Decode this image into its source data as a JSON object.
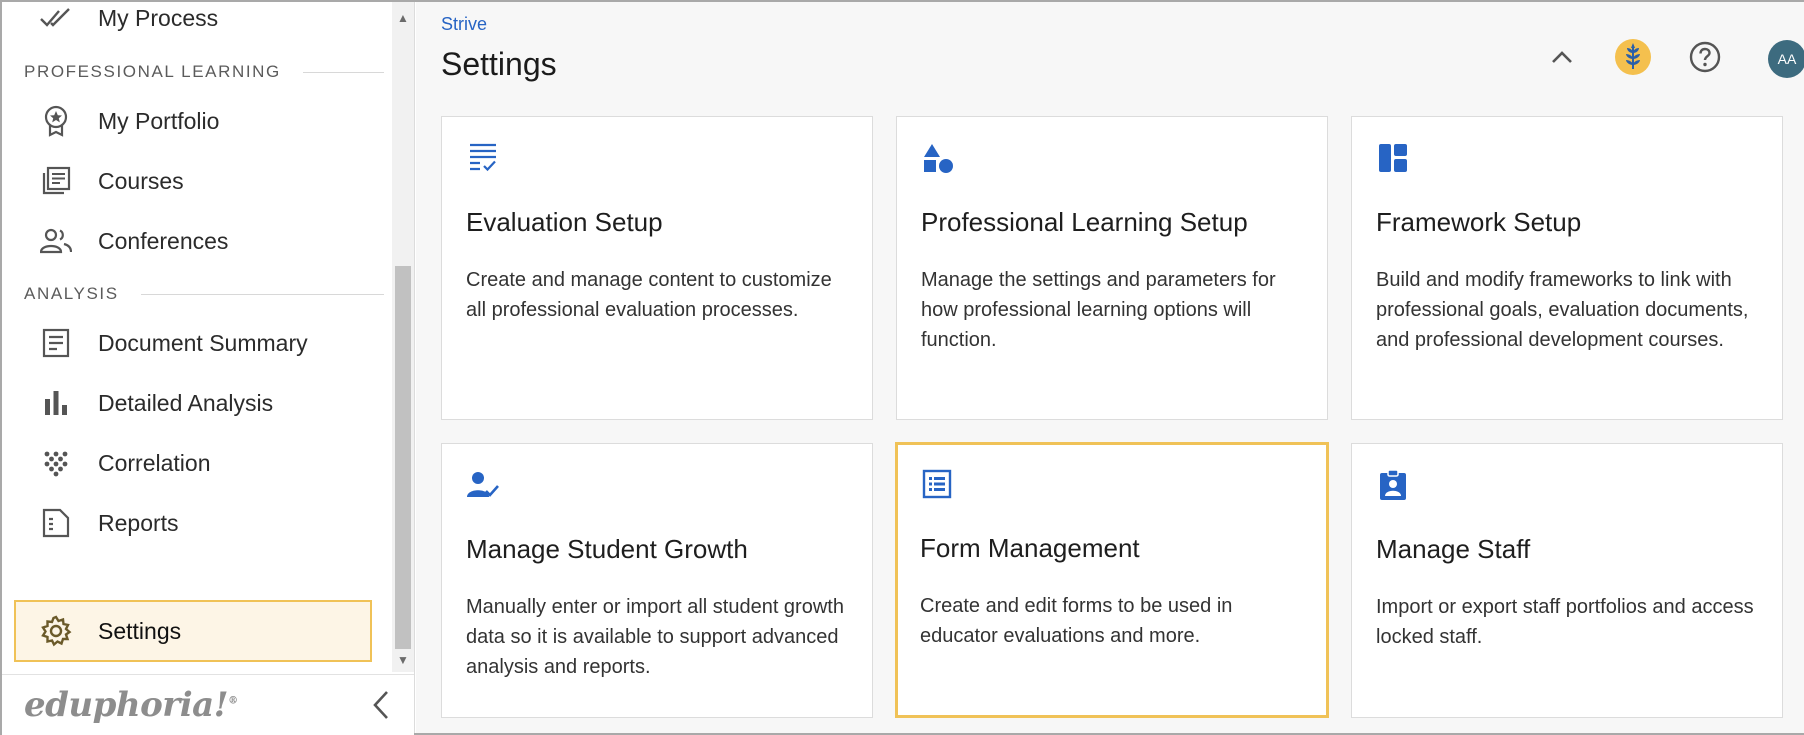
{
  "sidebar": {
    "top_item": {
      "label": "My Process",
      "icon": "double-check-icon"
    },
    "sections": [
      {
        "header": "PROFESSIONAL LEARNING"
      },
      {
        "header": "ANALYSIS"
      }
    ],
    "items": [
      {
        "label": "My Portfolio",
        "icon": "badge-star-icon"
      },
      {
        "label": "Courses",
        "icon": "library-books-icon"
      },
      {
        "label": "Conferences",
        "icon": "people-icon"
      },
      {
        "label": "Document Summary",
        "icon": "document-icon"
      },
      {
        "label": "Detailed Analysis",
        "icon": "bar-chart-icon"
      },
      {
        "label": "Correlation",
        "icon": "scatter-dots-icon"
      },
      {
        "label": "Reports",
        "icon": "report-file-icon"
      }
    ],
    "active_item": {
      "label": "Settings",
      "icon": "gear-icon"
    },
    "logo_text": "eduphoria!",
    "logo_mark": "®"
  },
  "header": {
    "breadcrumb": "Strive",
    "title": "Settings",
    "avatar_initials": "AA"
  },
  "cards": [
    {
      "title": "Evaluation Setup",
      "description": "Create and manage content to customize all professional evaluation processes.",
      "icon": "checklist-icon"
    },
    {
      "title": "Professional Learning Setup",
      "description": "Manage the settings and parameters for how professional learning options will function.",
      "icon": "shapes-icon"
    },
    {
      "title": "Framework Setup",
      "description": "Build and modify frameworks to link with professional goals, evaluation documents, and professional development courses.",
      "icon": "dashboard-icon"
    },
    {
      "title": "Manage Student Growth",
      "description": "Manually enter or import all student growth data so it is available to support advanced analysis and reports.",
      "icon": "person-check-icon"
    },
    {
      "title": "Form Management",
      "description": "Create and edit forms to be used in educator evaluations and more.",
      "icon": "list-form-icon"
    },
    {
      "title": "Manage Staff",
      "description": "Import or export staff portfolios and access locked staff.",
      "icon": "badge-clipboard-icon"
    }
  ],
  "colors": {
    "accent_blue": "#2764c4",
    "highlight_border": "#f0c257",
    "highlight_bg": "#fdf5e6",
    "avatar_bg": "#3d6b7f"
  }
}
